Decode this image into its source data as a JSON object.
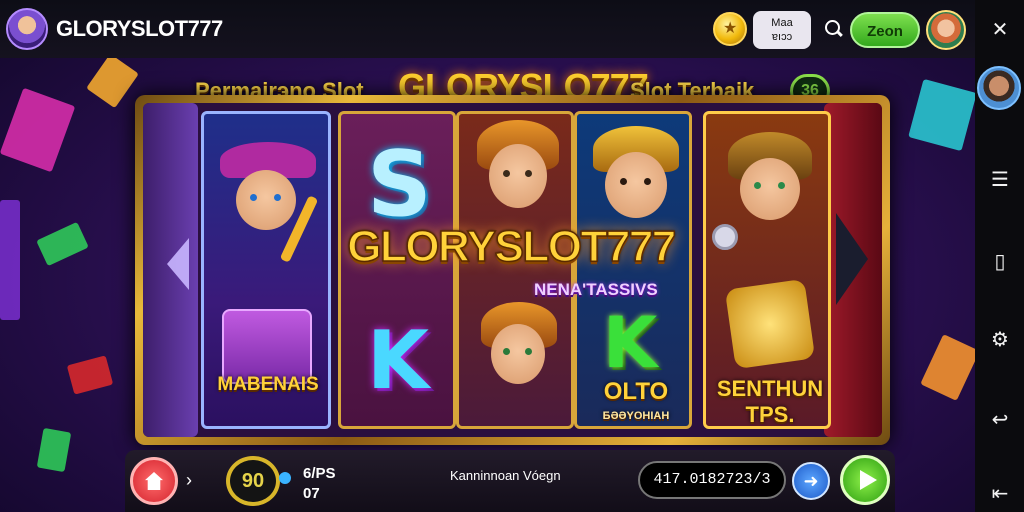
{
  "topbar": {
    "brand": "GLORYSLOT777",
    "balance_line1": "Maa",
    "balance_line2": "ɐıɔɔ",
    "login_label": "Zeon"
  },
  "header": {
    "left_text": "Permairэno Slot",
    "logo_text": "GLORYSLO777",
    "right_text": "Slot Terbaik",
    "badge_text": "36"
  },
  "reels": {
    "center_logo": "GLORYSLOT777",
    "center_sub": "NENA'TASSIVS",
    "symbol_box_caption": "MABENAIS",
    "symbol_k1": "K",
    "symbol_s": "S",
    "symbol_k2": "K",
    "reel4_caption": "OLTO",
    "reel4_subcaption": "ƂƏƏYOHIAH",
    "reel5_caption_line1": "SENTHUN",
    "reel5_caption_line2": "TPS."
  },
  "bottombar": {
    "bet_value": "90",
    "bet_label_line1": "6/PS",
    "bet_label_line2": "07",
    "info_text": "Kanninnoan Vóegn",
    "credit_value": "417.0182723/3"
  },
  "icons": {
    "close": "close-icon",
    "menu": "menu-icon",
    "window": "window-icon",
    "settings": "gear-icon",
    "back": "back-icon",
    "home": "home-icon"
  },
  "colors": {
    "accent_gold": "#ffd23a",
    "spin_green": "#2c9e10",
    "go_blue": "#1d5ac8",
    "home_red": "#d4232e"
  }
}
